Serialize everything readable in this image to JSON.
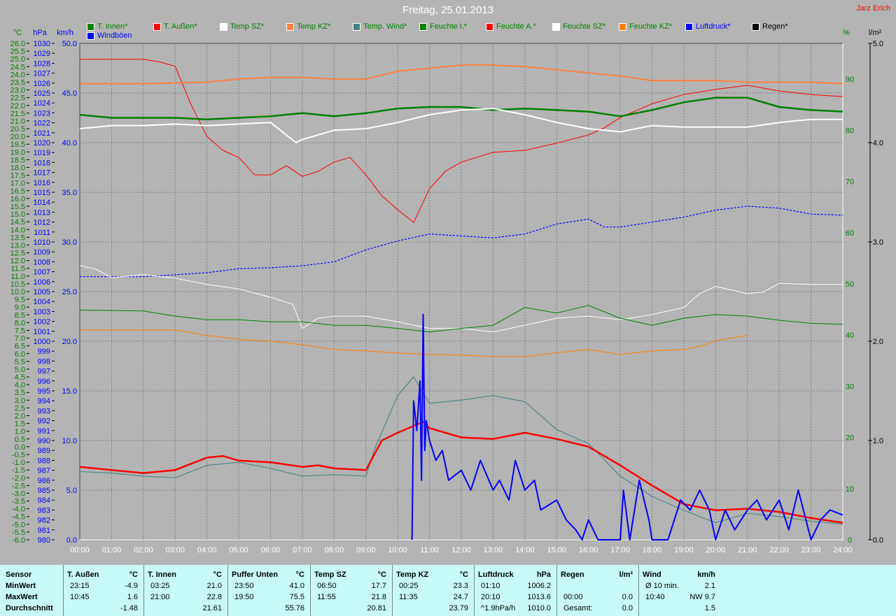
{
  "title": "Freitag, 25.01.2013",
  "author": "Jarz Erich",
  "legend": [
    {
      "label": "T. Innen*",
      "color": "#008000",
      "text_color": "#008000"
    },
    {
      "label": "T. Außen*",
      "color": "#ff0000",
      "text_color": "#008000"
    },
    {
      "label": "Temp SZ*",
      "color": "#ffffff",
      "text_color": "#008000"
    },
    {
      "label": "Temp KZ*",
      "color": "#ff8040",
      "text_color": "#008000"
    },
    {
      "label": "Temp. Wind*",
      "color": "#408080",
      "text_color": "#008000"
    },
    {
      "label": "Feuchte I.*",
      "color": "#008000",
      "text_color": "#008000"
    },
    {
      "label": "Feuchte A.*",
      "color": "#ff0000",
      "text_color": "#008000"
    },
    {
      "label": "Feuchte SZ*",
      "color": "#ffffff",
      "text_color": "#008000"
    },
    {
      "label": "Feuchte KZ*",
      "color": "#ff8000",
      "text_color": "#008000"
    },
    {
      "label": "Luftdruck*",
      "color": "#0000ff",
      "text_color": "#0000ff"
    },
    {
      "label": "Regen*",
      "color": "#000000",
      "text_color": "#000000"
    },
    {
      "label": "Windböen",
      "color": "#0000ff",
      "text_color": "#0000ff"
    }
  ],
  "chart_data": {
    "type": "line",
    "title": "Freitag, 25.01.2013",
    "xlabel": "",
    "x_ticks": [
      "00:00",
      "01:00",
      "02:00",
      "03:00",
      "04:00",
      "05:00",
      "06:00",
      "07:00",
      "08:00",
      "09:00",
      "10:00",
      "11:00",
      "12:00",
      "13:00",
      "14:00",
      "15:00",
      "16:00",
      "17:00",
      "18:00",
      "19:00",
      "20:00",
      "21:00",
      "22:00",
      "23:00",
      "24:00"
    ],
    "xlim": [
      0,
      24
    ],
    "axes": {
      "temp": {
        "unit": "°C",
        "range": [
          -6,
          26
        ],
        "step": 0.5,
        "color": "#008000"
      },
      "pressure": {
        "unit": "hPa",
        "range": [
          980,
          1030
        ],
        "step": 1,
        "color": "#0000ff"
      },
      "wind": {
        "unit": "km/h",
        "range": [
          0,
          50
        ],
        "step": 5,
        "color": "#0000ff"
      },
      "humidity": {
        "unit": "%",
        "range": [
          0,
          97
        ],
        "ticks": [
          0,
          10,
          20,
          30,
          40,
          50,
          60,
          70,
          80,
          90
        ],
        "color": "#008000"
      },
      "rain": {
        "unit": "l/m²",
        "range": [
          0,
          5
        ],
        "step": 1,
        "color": "#000000"
      }
    },
    "grid": true,
    "series": [
      {
        "name": "Feuchte A.",
        "axis": "humidity",
        "color": "#ff0000",
        "width": 1,
        "x": [
          0,
          1,
          2,
          2.5,
          3,
          3.5,
          4,
          4.5,
          5,
          5.5,
          6,
          6.5,
          7,
          7.5,
          8,
          8.5,
          9,
          9.5,
          10,
          10.5,
          11,
          11.5,
          12,
          13,
          14,
          15,
          16,
          16.5,
          17,
          18,
          19,
          20,
          21,
          22,
          23,
          24
        ],
        "y": [
          93.9,
          93.9,
          93.9,
          93.4,
          92.5,
          85.0,
          78.8,
          76.1,
          74.7,
          71.3,
          71.3,
          73.1,
          71.0,
          72.0,
          73.8,
          74.7,
          71.3,
          67.2,
          64.5,
          62.0,
          68.6,
          72.0,
          73.8,
          75.7,
          76.1,
          77.5,
          79.1,
          80.5,
          82.5,
          85.2,
          87.0,
          88.0,
          88.8,
          87.7,
          87.0,
          86.6
        ]
      },
      {
        "name": "Temp KZ",
        "axis": "temp",
        "color": "#ff8040",
        "width": 2,
        "x": [
          0,
          2,
          4,
          5,
          6,
          7,
          8,
          9,
          10,
          11,
          12,
          13,
          14,
          15,
          16,
          17,
          18,
          19,
          20,
          21,
          22,
          23,
          24
        ],
        "y": [
          23.4,
          23.4,
          23.5,
          23.7,
          23.8,
          23.8,
          23.7,
          23.7,
          24.2,
          24.4,
          24.6,
          24.6,
          24.5,
          24.3,
          24.1,
          23.9,
          23.6,
          23.6,
          23.6,
          23.5,
          23.5,
          23.5,
          23.4
        ]
      },
      {
        "name": "T. Innen",
        "axis": "temp",
        "color": "#008000",
        "width": 2.5,
        "x": [
          0,
          1,
          2,
          3,
          4,
          5,
          6,
          7,
          8,
          9,
          10,
          11,
          12,
          13,
          14,
          15,
          16,
          17,
          18,
          19,
          20,
          21,
          22,
          23,
          24
        ],
        "y": [
          21.4,
          21.2,
          21.2,
          21.2,
          21.1,
          21.2,
          21.3,
          21.5,
          21.3,
          21.5,
          21.8,
          21.9,
          21.9,
          21.7,
          21.8,
          21.7,
          21.6,
          21.3,
          21.7,
          22.2,
          22.5,
          22.5,
          21.9,
          21.7,
          21.6
        ]
      },
      {
        "name": "Temp SZ",
        "axis": "temp",
        "color": "#ffffff",
        "width": 2,
        "x": [
          0,
          1,
          2,
          3,
          4,
          5,
          6,
          6.8,
          7,
          8,
          9,
          10,
          11,
          12,
          13,
          14,
          15,
          16,
          17,
          18,
          19,
          20,
          21,
          22,
          23,
          24
        ],
        "y": [
          20.5,
          20.7,
          20.7,
          20.8,
          20.7,
          20.8,
          20.9,
          19.6,
          19.8,
          20.4,
          20.5,
          20.9,
          21.4,
          21.7,
          21.8,
          21.4,
          20.9,
          20.5,
          20.3,
          20.7,
          20.6,
          20.6,
          20.6,
          20.9,
          21.1,
          21.1
        ]
      },
      {
        "name": "Luftdruck",
        "axis": "pressure",
        "color": "#0000ff",
        "width": 1.2,
        "dashed": true,
        "x": [
          0,
          1,
          2,
          3,
          4,
          5,
          6,
          7,
          8,
          9,
          10,
          11,
          12,
          13,
          14,
          15,
          16,
          16.5,
          17,
          18,
          19,
          20,
          21,
          22,
          23,
          24
        ],
        "y": [
          1006.5,
          1006.5,
          1006.5,
          1006.7,
          1006.9,
          1007.3,
          1007.4,
          1007.6,
          1008.0,
          1009.2,
          1010.1,
          1010.8,
          1010.6,
          1010.4,
          1010.8,
          1011.8,
          1012.3,
          1011.5,
          1011.5,
          1012.0,
          1012.5,
          1013.2,
          1013.6,
          1013.4,
          1012.8,
          1012.7
        ]
      },
      {
        "name": "Feuchte SZ",
        "axis": "humidity",
        "color": "#ffffff",
        "width": 1,
        "x": [
          0,
          0.5,
          1,
          2,
          3,
          4,
          5,
          6,
          6.7,
          7,
          7.5,
          8,
          9,
          10,
          11,
          12,
          13,
          14,
          15,
          16,
          17,
          18,
          19,
          19.5,
          20,
          21,
          21.5,
          22,
          23,
          24
        ],
        "y": [
          53.6,
          52.9,
          51.2,
          51.8,
          51.1,
          49.9,
          49.0,
          47.4,
          46.0,
          41.3,
          43.3,
          43.7,
          43.7,
          42.6,
          41.3,
          41.3,
          40.6,
          41.9,
          43.3,
          43.7,
          43.0,
          44.0,
          45.4,
          48.1,
          49.5,
          48.1,
          48.4,
          50.1,
          49.9,
          49.9
        ]
      },
      {
        "name": "Feuchte I.",
        "axis": "humidity",
        "color": "#008000",
        "width": 1,
        "x": [
          0,
          2,
          3,
          4,
          5,
          6,
          7,
          8,
          9,
          10,
          11,
          12,
          13,
          14,
          15,
          16,
          17,
          18,
          19,
          20,
          21,
          22,
          23,
          24
        ],
        "y": [
          44.9,
          44.7,
          43.7,
          43.0,
          43.0,
          42.6,
          42.6,
          41.9,
          41.9,
          41.3,
          40.6,
          41.3,
          41.9,
          45.4,
          44.3,
          45.8,
          43.3,
          41.9,
          43.3,
          44.0,
          43.7,
          42.9,
          42.3,
          42.1
        ]
      },
      {
        "name": "Feuchte KZ",
        "axis": "humidity",
        "color": "#ff8000",
        "width": 1,
        "x": [
          0,
          3,
          4,
          5,
          6,
          7,
          8,
          9,
          10,
          11,
          12,
          13,
          14,
          15,
          16,
          17,
          18,
          19,
          19.5,
          20,
          21
        ],
        "y": [
          41.0,
          41.0,
          39.9,
          39.2,
          38.8,
          38.1,
          37.2,
          36.9,
          36.5,
          36.2,
          36.1,
          35.8,
          35.8,
          36.5,
          37.2,
          36.2,
          36.9,
          37.2,
          37.8,
          38.9,
          39.9
        ]
      },
      {
        "name": "Temp. Wind",
        "axis": "temp",
        "color": "#408080",
        "width": 1,
        "x": [
          0,
          1,
          2,
          3,
          4,
          5,
          6,
          7,
          8,
          9,
          9.3,
          10,
          10.5,
          11,
          12,
          13,
          14,
          15,
          16,
          17,
          18,
          19,
          20,
          21,
          22,
          23,
          24
        ],
        "y": [
          -1.6,
          -1.7,
          -1.9,
          -2.0,
          -1.2,
          -1.0,
          -1.4,
          -1.9,
          -1.8,
          -1.9,
          0.0,
          3.3,
          4.5,
          2.8,
          3.0,
          3.3,
          2.9,
          1.1,
          0.2,
          -1.9,
          -3.2,
          -4.1,
          -4.9,
          -4.3,
          -4.5,
          -4.8,
          -5.0
        ]
      },
      {
        "name": "T. Außen",
        "axis": "temp",
        "color": "#ff0000",
        "width": 2.5,
        "x": [
          0,
          1,
          2,
          3,
          4,
          4.5,
          5,
          6,
          7,
          7.5,
          8,
          9,
          9.5,
          10,
          10.8,
          11,
          12,
          13,
          14,
          15,
          16,
          17,
          18,
          19,
          20,
          21,
          22,
          23,
          24
        ],
        "y": [
          -1.3,
          -1.5,
          -1.7,
          -1.5,
          -0.7,
          -0.6,
          -0.9,
          -1.0,
          -1.3,
          -1.2,
          -1.4,
          -1.5,
          0.4,
          0.9,
          1.6,
          1.2,
          0.6,
          0.5,
          0.9,
          0.5,
          0.0,
          -1.2,
          -2.5,
          -3.7,
          -4.1,
          -4.0,
          -4.2,
          -4.6,
          -4.9
        ]
      },
      {
        "name": "Windböen",
        "axis": "wind",
        "color": "#0000ff",
        "width": 2,
        "x": [
          10.45,
          10.5,
          10.6,
          10.7,
          10.75,
          10.8,
          10.85,
          10.9,
          11,
          11.2,
          11.4,
          11.6,
          12,
          12.3,
          12.6,
          13,
          13.2,
          13.5,
          13.7,
          14,
          14.3,
          14.5,
          15,
          15.3,
          15.6,
          15.8,
          16,
          16.3,
          17,
          17.1,
          17.3,
          17.6,
          17.9,
          18,
          18.5,
          18.9,
          19.2,
          19.5,
          19.8,
          20,
          20.3,
          20.6,
          21,
          21.3,
          21.6,
          22,
          22.3,
          22.6,
          23,
          23.3,
          23.6,
          24
        ],
        "y": [
          0,
          14,
          11,
          16,
          6,
          22.7,
          9,
          12,
          10,
          8,
          9,
          6,
          7,
          5,
          8,
          5,
          6,
          4,
          8,
          5,
          6,
          3,
          4,
          2,
          1,
          0,
          2,
          0,
          0,
          5,
          0,
          6,
          2,
          0,
          0,
          4,
          3,
          5,
          3,
          0,
          3,
          1,
          3,
          4,
          2,
          4,
          1,
          5,
          0,
          2,
          3,
          2.5
        ]
      },
      {
        "name": "Regen",
        "axis": "rain",
        "color": "#000000",
        "width": 1,
        "x": [],
        "y": []
      }
    ]
  },
  "table": {
    "sensor_col": [
      "Sensor",
      "MinWert",
      "MaxWert",
      "Durchschnitt"
    ],
    "groups": [
      {
        "name": "T. Außen",
        "unit": "°C",
        "rows": [
          [
            "23:15",
            "-4.9"
          ],
          [
            "10:45",
            "1.6"
          ],
          [
            "",
            "-1.48"
          ]
        ]
      },
      {
        "name": "T. Innen",
        "unit": "°C",
        "rows": [
          [
            "03:25",
            "21.0"
          ],
          [
            "21:00",
            "22.8"
          ],
          [
            "",
            "21.61"
          ]
        ]
      },
      {
        "name": "Puffer Unten",
        "unit": "°C",
        "rows": [
          [
            "23:50",
            "41.0"
          ],
          [
            "19:50",
            "75.5"
          ],
          [
            "",
            "55.76"
          ]
        ]
      },
      {
        "name": "Temp SZ",
        "unit": "°C",
        "rows": [
          [
            "06:50",
            "17.7"
          ],
          [
            "11:55",
            "21.8"
          ],
          [
            "",
            "20.81"
          ]
        ]
      },
      {
        "name": "Temp KZ",
        "unit": "°C",
        "rows": [
          [
            "00:25",
            "23.3"
          ],
          [
            "11:35",
            "24.7"
          ],
          [
            "",
            "23.79"
          ]
        ]
      },
      {
        "name": "Luftdruck",
        "unit": "hPa",
        "rows": [
          [
            "01:10",
            "1006.2"
          ],
          [
            "20:10",
            "1013.6"
          ],
          [
            "^1.9hPa/h",
            "1010.0"
          ]
        ]
      },
      {
        "name": "Regen",
        "unit": "l/m²",
        "rows": [
          [
            "",
            ""
          ],
          [
            "00:00",
            "0.0"
          ],
          [
            "Gesamt:",
            "0.0"
          ]
        ]
      },
      {
        "name": "Wind",
        "unit": "km/h",
        "rows": [
          [
            "Ø 10 min.",
            "2.1"
          ],
          [
            "10:40",
            "NW 9.7"
          ],
          [
            "",
            "1.5"
          ]
        ]
      }
    ]
  }
}
